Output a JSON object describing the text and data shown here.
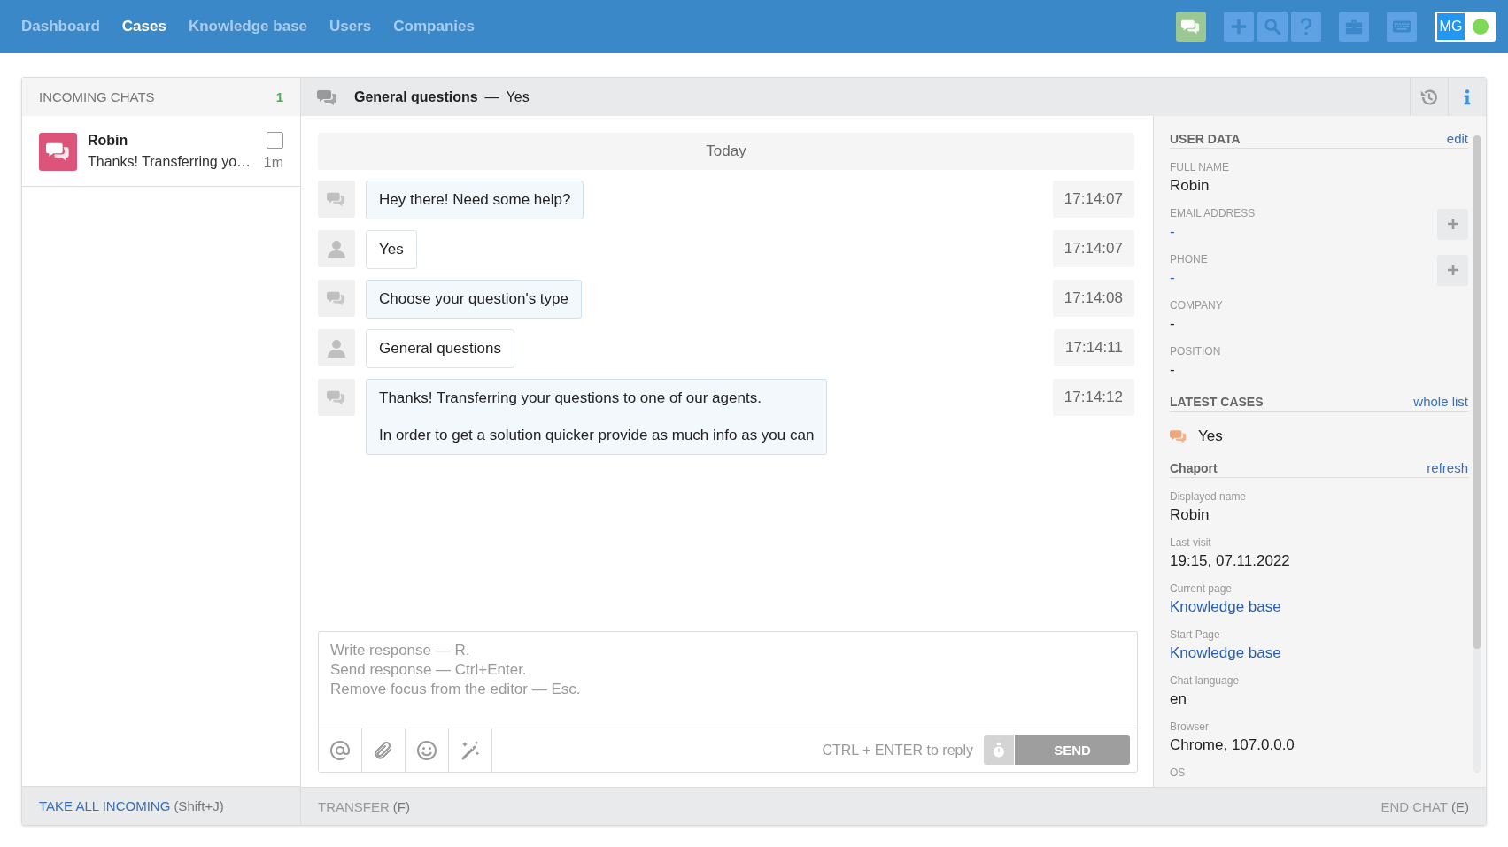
{
  "nav": {
    "items": [
      {
        "label": "Dashboard",
        "selected": false
      },
      {
        "label": "Cases",
        "selected": true
      },
      {
        "label": "Knowledge base",
        "selected": false
      },
      {
        "label": "Users",
        "selected": false
      },
      {
        "label": "Companies",
        "selected": false
      }
    ],
    "initials": "MG",
    "online": true
  },
  "incoming": {
    "title": "INCOMING CHATS",
    "count": "1",
    "chats": [
      {
        "name": "Robin",
        "preview": "Thanks! Transferring yo…",
        "time": "1m",
        "checked": false
      }
    ],
    "footer_action": "TAKE ALL INCOMING",
    "footer_hint": "(Shift+J)"
  },
  "conversation": {
    "topic": "General questions",
    "separator": "—",
    "subject": "Yes",
    "date_divider": "Today",
    "messages": [
      {
        "kind": "bot",
        "lines": [
          "Hey there! Need some help?"
        ],
        "time": "17:14:07"
      },
      {
        "kind": "visitor",
        "lines": [
          "Yes"
        ],
        "time": "17:14:07"
      },
      {
        "kind": "bot",
        "lines": [
          "Choose your question's type"
        ],
        "time": "17:14:08"
      },
      {
        "kind": "visitor",
        "lines": [
          "General questions"
        ],
        "time": "17:14:11"
      },
      {
        "kind": "bot",
        "lines": [
          "Thanks! Transferring your questions to one of our agents.",
          "In order to get a solution quicker provide as much info as you can"
        ],
        "time": "17:14:12"
      }
    ],
    "composer": {
      "placeholder": "Write response — R.\nSend response — Ctrl+Enter.\nRemove focus from the editor — Esc.",
      "hint": "CTRL + ENTER to reply",
      "send": "SEND"
    },
    "footer_action": "TRANSFER",
    "footer_hint": "(F)",
    "end_action": "END CHAT",
    "end_hint": "(E)"
  },
  "sidebar": {
    "sections": [
      {
        "kind": "fields",
        "heading": "USER DATA",
        "action": "edit",
        "fields": [
          {
            "label": "FULL NAME",
            "value": "Robin",
            "link": false,
            "addable": false
          },
          {
            "label": "EMAIL ADDRESS",
            "value": "-",
            "link": true,
            "addable": true
          },
          {
            "label": "PHONE",
            "value": "-",
            "link": true,
            "addable": true
          },
          {
            "label": "COMPANY",
            "value": "-",
            "link": false,
            "addable": false
          },
          {
            "label": "POSITION",
            "value": "-",
            "link": false,
            "addable": false
          }
        ]
      },
      {
        "kind": "cases",
        "heading": "LATEST CASES",
        "action": "whole list",
        "cases": [
          {
            "title": "Yes"
          }
        ]
      },
      {
        "kind": "fields",
        "heading": "Chaport",
        "action": "refresh",
        "fields": [
          {
            "label": "Displayed name",
            "value": "Robin",
            "link": false,
            "addable": false
          },
          {
            "label": "Last visit",
            "value": "19:15, 07.11.2022",
            "link": false,
            "addable": false
          },
          {
            "label": "Current page",
            "value": "Knowledge base",
            "link": true,
            "addable": false
          },
          {
            "label": "Start Page",
            "value": "Knowledge base",
            "link": true,
            "addable": false
          },
          {
            "label": "Chat language",
            "value": "en",
            "link": false,
            "addable": false
          },
          {
            "label": "Browser",
            "value": "Chrome, 107.0.0.0",
            "link": false,
            "addable": false
          },
          {
            "label": "OS"
          }
        ]
      }
    ]
  }
}
